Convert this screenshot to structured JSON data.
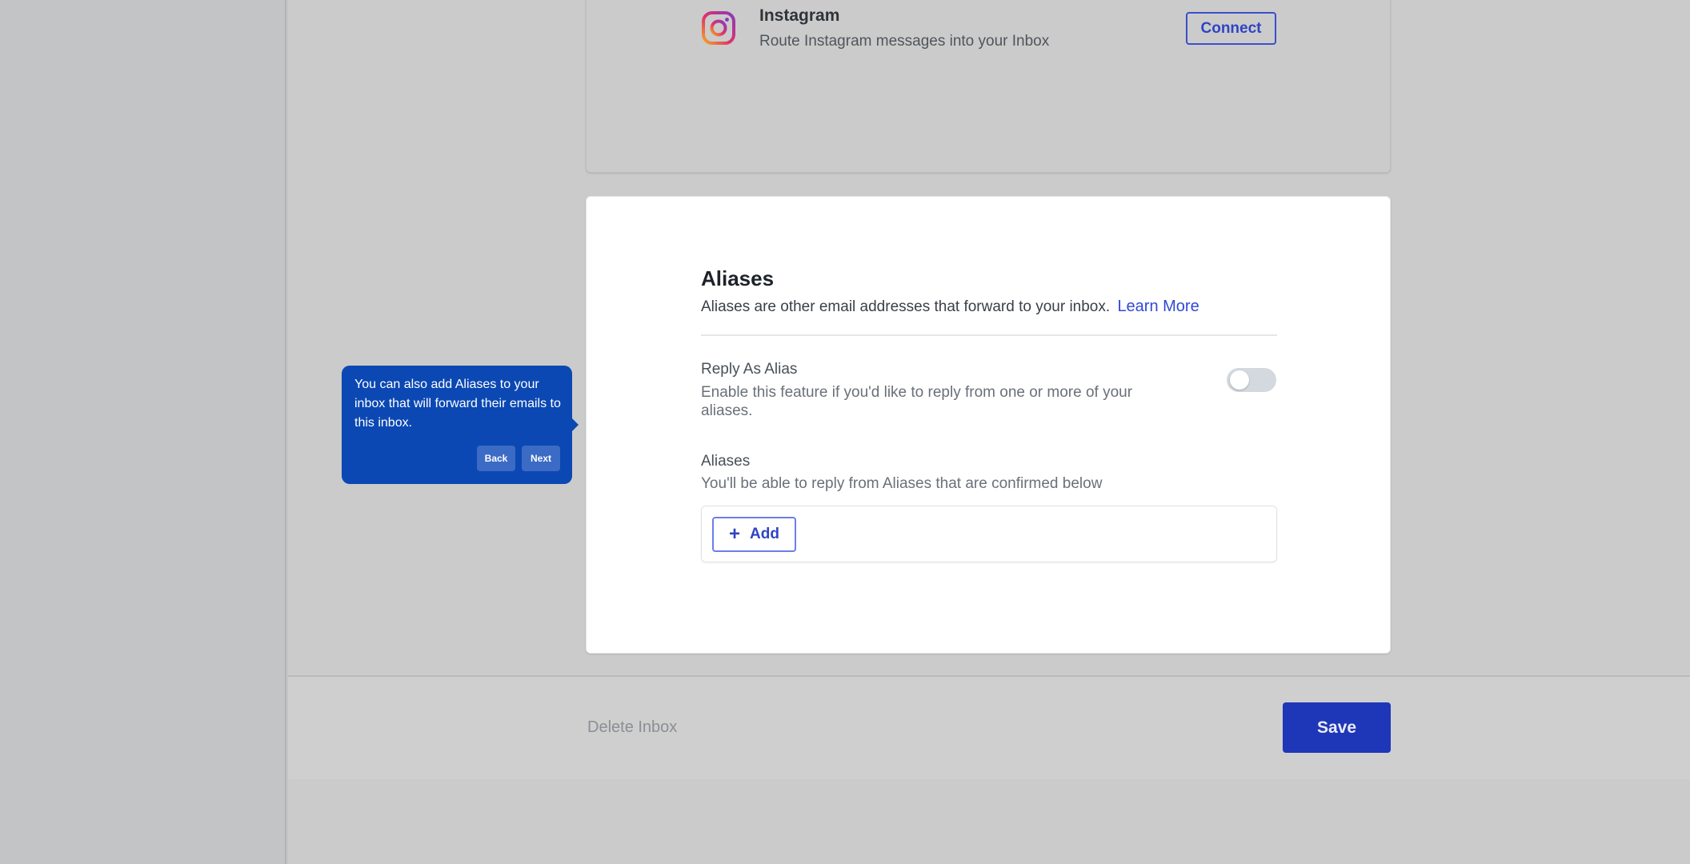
{
  "instagram": {
    "name": "Instagram",
    "description": "Route Instagram messages into your Inbox",
    "connect_label": "Connect",
    "icon": "instagram-logo-icon"
  },
  "aliases_card": {
    "title": "Aliases",
    "description": "Aliases are other email addresses that forward to your inbox.",
    "learn_more": "Learn More",
    "reply_as_alias": {
      "label": "Reply As Alias",
      "help": "Enable this feature if you'd like to reply from one or more of your aliases.",
      "enabled": false
    },
    "aliases_section": {
      "label": "Aliases",
      "help": "You'll be able to reply from Aliases that are confirmed below",
      "add_label": "Add"
    }
  },
  "footer": {
    "delete_label": "Delete Inbox",
    "save_label": "Save"
  },
  "tour_tooltip": {
    "text": "You can also add Aliases to your inbox that will forward their emails to this inbox.",
    "back_label": "Back",
    "next_label": "Next"
  },
  "colors": {
    "accent": "#2f44c4",
    "save_button": "#1e36b8",
    "tooltip": "#0b48b3",
    "overlay": "#cbcbcb"
  }
}
